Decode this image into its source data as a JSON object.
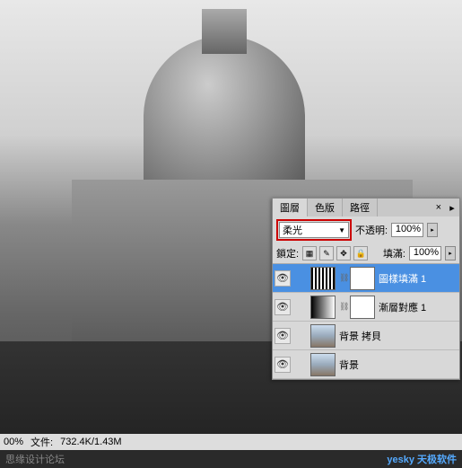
{
  "status": {
    "zoom": "00%",
    "file_label": "文件:",
    "file_size": "732.4K/1.43M"
  },
  "watermark": {
    "left": "思缘设计论坛",
    "right": "yesky 天极软件"
  },
  "panel": {
    "tabs": {
      "layers": "圖層",
      "channels": "色版",
      "paths": "路徑"
    },
    "blend_mode": "柔光",
    "opacity_label": "不透明:",
    "opacity_value": "100%",
    "lock_label": "鎖定:",
    "fill_label": "填滿:",
    "fill_value": "100%"
  },
  "layers": [
    {
      "name": "圖樣填滿 1",
      "visible": true,
      "selected": true,
      "thumb": "pattern",
      "has_mask": true
    },
    {
      "name": "漸層對應 1",
      "visible": true,
      "selected": false,
      "thumb": "gradient",
      "has_mask": true
    },
    {
      "name": "背景 拷貝",
      "visible": true,
      "selected": false,
      "thumb": "photo",
      "has_mask": false
    },
    {
      "name": "背景",
      "visible": true,
      "selected": false,
      "thumb": "photo",
      "has_mask": false
    }
  ],
  "icons": {
    "eye": "👁",
    "close": "×",
    "menu": "▸",
    "dropdown": "▼",
    "arrow": "▸",
    "link": "⛓",
    "lock_pixel": "▦",
    "lock_brush": "✎",
    "lock_move": "✥",
    "lock_all": "🔒"
  }
}
